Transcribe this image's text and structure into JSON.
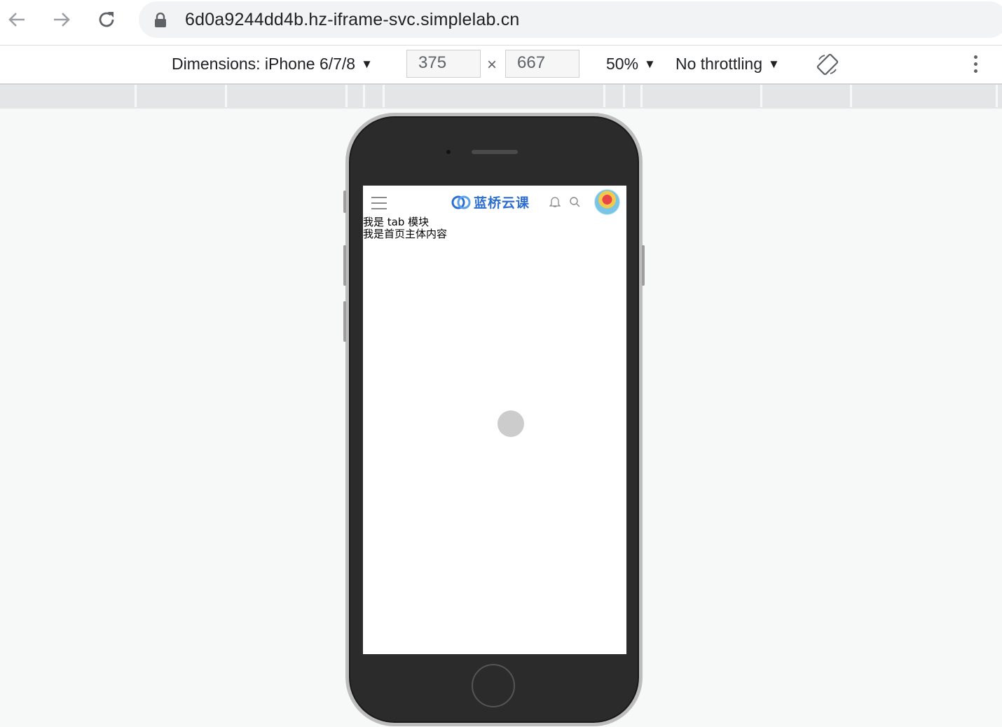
{
  "browser": {
    "url": "6d0a9244dd4b.hz-iframe-svc.simplelab.cn",
    "back_icon": "arrow-left-icon",
    "forward_icon": "arrow-right-icon",
    "reload_icon": "reload-icon",
    "lock_icon": "lock-icon"
  },
  "device_toolbar": {
    "dimensions_label": "Dimensions: iPhone 6/7/8",
    "width": "375",
    "height": "667",
    "times": "×",
    "zoom": "50%",
    "throttling": "No throttling",
    "caret": "▼",
    "rotate_icon": "rotate-icon",
    "more_icon": "more-vertical-icon"
  },
  "app": {
    "logo_text": "蓝桥云课",
    "tab_module_text": "我是 tab 模块",
    "home_content_text": "我是首页主体内容",
    "menu_icon": "menu-icon",
    "bell_icon": "bell-icon",
    "search_icon": "search-icon",
    "brand_color": "#2d6fd1"
  }
}
